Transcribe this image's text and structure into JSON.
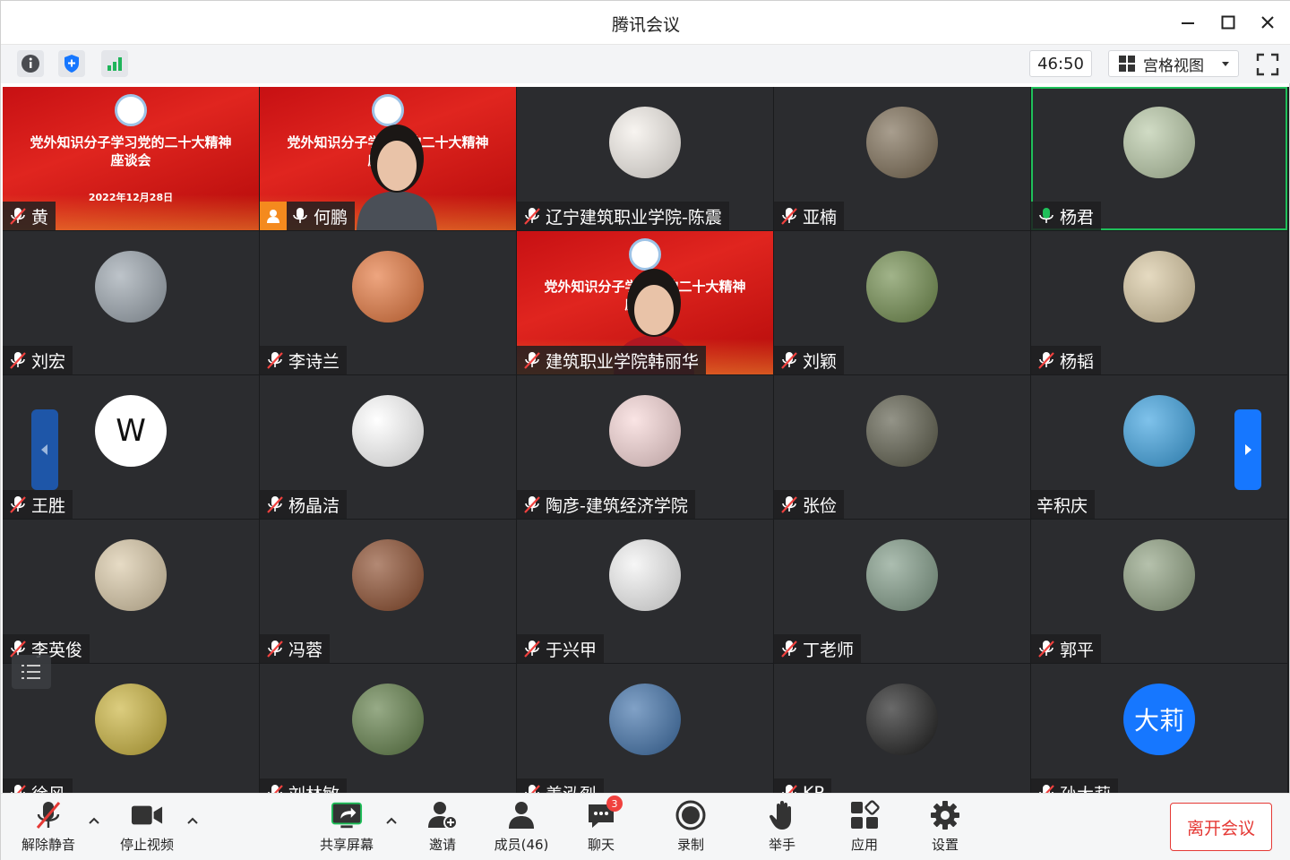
{
  "window": {
    "title": "腾讯会议"
  },
  "toolbar": {
    "timer": "46:50",
    "view_label": "宫格视图"
  },
  "colors": {
    "accent": "#1677ff",
    "speaking": "#1fc05a",
    "leave": "#e53935",
    "tile_bg": "#2b2c2f"
  },
  "participants": [
    {
      "name": "黄",
      "muted": true,
      "kind": "banner"
    },
    {
      "name": "何鹏",
      "muted": false,
      "kind": "banner-person",
      "host_badge": true
    },
    {
      "name": "辽宁建筑职业学院-陈震",
      "muted": true,
      "kind": "avatar",
      "avatar_color": "#f4efe9"
    },
    {
      "name": "亚楠",
      "muted": true,
      "kind": "avatar",
      "avatar_color": "#7a6a52"
    },
    {
      "name": "杨君",
      "muted": false,
      "kind": "avatar",
      "avatar_color": "#b8c9a6",
      "speaking": true
    },
    {
      "name": "刘宏",
      "muted": true,
      "kind": "avatar",
      "avatar_color": "#9aa4ad"
    },
    {
      "name": "李诗兰",
      "muted": true,
      "kind": "avatar",
      "avatar_color": "#e4753b"
    },
    {
      "name": "建筑职业学院韩丽华",
      "muted": true,
      "kind": "banner-person"
    },
    {
      "name": "刘颖",
      "muted": true,
      "kind": "avatar",
      "avatar_color": "#6f8b4b"
    },
    {
      "name": "杨韬",
      "muted": true,
      "kind": "avatar",
      "avatar_color": "#d8c7a0"
    },
    {
      "name": "王胜",
      "muted": true,
      "kind": "avatar-text",
      "avatar_color": "#ffffff",
      "avatar_text": "W"
    },
    {
      "name": "杨晶洁",
      "muted": true,
      "kind": "avatar",
      "avatar_color": "#ffffff"
    },
    {
      "name": "陶彦-建筑经济学院",
      "muted": true,
      "kind": "avatar",
      "avatar_color": "#f7d6d6"
    },
    {
      "name": "张俭",
      "muted": true,
      "kind": "avatar",
      "avatar_color": "#5a5a48"
    },
    {
      "name": "辛积庆",
      "muted": null,
      "kind": "avatar",
      "avatar_color": "#3aa1e0"
    },
    {
      "name": "李英俊",
      "muted": true,
      "kind": "avatar",
      "avatar_color": "#d9c8a6"
    },
    {
      "name": "冯蓉",
      "muted": true,
      "kind": "avatar",
      "avatar_color": "#8a4a2a"
    },
    {
      "name": "于兴甲",
      "muted": true,
      "kind": "avatar",
      "avatar_color": "#f2f2f2"
    },
    {
      "name": "丁老师",
      "muted": true,
      "kind": "avatar",
      "avatar_color": "#7f9a86"
    },
    {
      "name": "郭平",
      "muted": true,
      "kind": "avatar",
      "avatar_color": "#8ea080"
    },
    {
      "name": "徐风",
      "muted": true,
      "kind": "avatar",
      "avatar_color": "#c9b23a"
    },
    {
      "name": "刘林敏",
      "muted": true,
      "kind": "avatar",
      "avatar_color": "#5f7d46"
    },
    {
      "name": "姜泓烈",
      "muted": true,
      "kind": "avatar",
      "avatar_color": "#3d6fa8"
    },
    {
      "name": "KP",
      "muted": true,
      "kind": "avatar",
      "avatar_color": "#1a1a1a"
    },
    {
      "name": "孙大莉",
      "muted": true,
      "kind": "avatar-text",
      "avatar_color": "#1677ff",
      "avatar_text": "大莉"
    }
  ],
  "banner": {
    "title_line1": "党外知识分子学习党的二十大精神",
    "title_line2": "座谈会",
    "date": "2022年12月28日"
  },
  "bottombar": {
    "unmute": "解除静音",
    "stop_video": "停止视频",
    "share_screen": "共享屏幕",
    "invite": "邀请",
    "members": "成员(46)",
    "chat": "聊天",
    "chat_badge": "3",
    "record": "录制",
    "raise_hand": "举手",
    "apps": "应用",
    "settings": "设置",
    "leave": "离开会议"
  }
}
